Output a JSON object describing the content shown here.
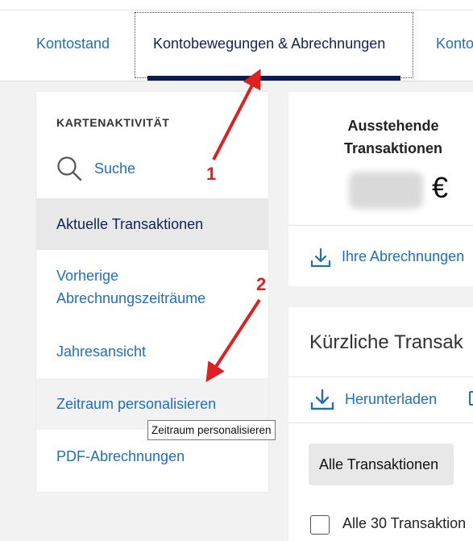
{
  "tabs": {
    "account_balance": "Kontostand",
    "movements": "Kontobewegungen & Abrechnungen",
    "partial": "Konto"
  },
  "sidebar": {
    "heading": "KARTENAKTIVITÄT",
    "search_label": "Suche",
    "items": [
      {
        "label": "Aktuelle Transaktionen"
      },
      {
        "label": "Vorherige Abrechnungszeiträume"
      },
      {
        "label": "Jahresansicht"
      },
      {
        "label": "Zeitraum personalisieren"
      },
      {
        "label": "PDF-Abrechnungen"
      }
    ]
  },
  "tooltip": "Zeitraum personalisieren",
  "pending": {
    "title": "Ausstehende\nTransaktionen",
    "currency": "€",
    "statements_link": "Ihre Abrechnungen"
  },
  "recent": {
    "title": "Kürzliche Transak",
    "download_label": "Herunterladen",
    "filter_button": "Alle Transaktionen",
    "checkbox_label": "Alle 30 Transaktion"
  },
  "annotations": {
    "first": "1",
    "second": "2"
  },
  "colors": {
    "link": "#1f6fc1",
    "navy": "#10245a",
    "annotation_red": "#e02020"
  },
  "icons": [
    "search-icon",
    "download-icon",
    "document-icon",
    "arrow-annotation"
  ]
}
